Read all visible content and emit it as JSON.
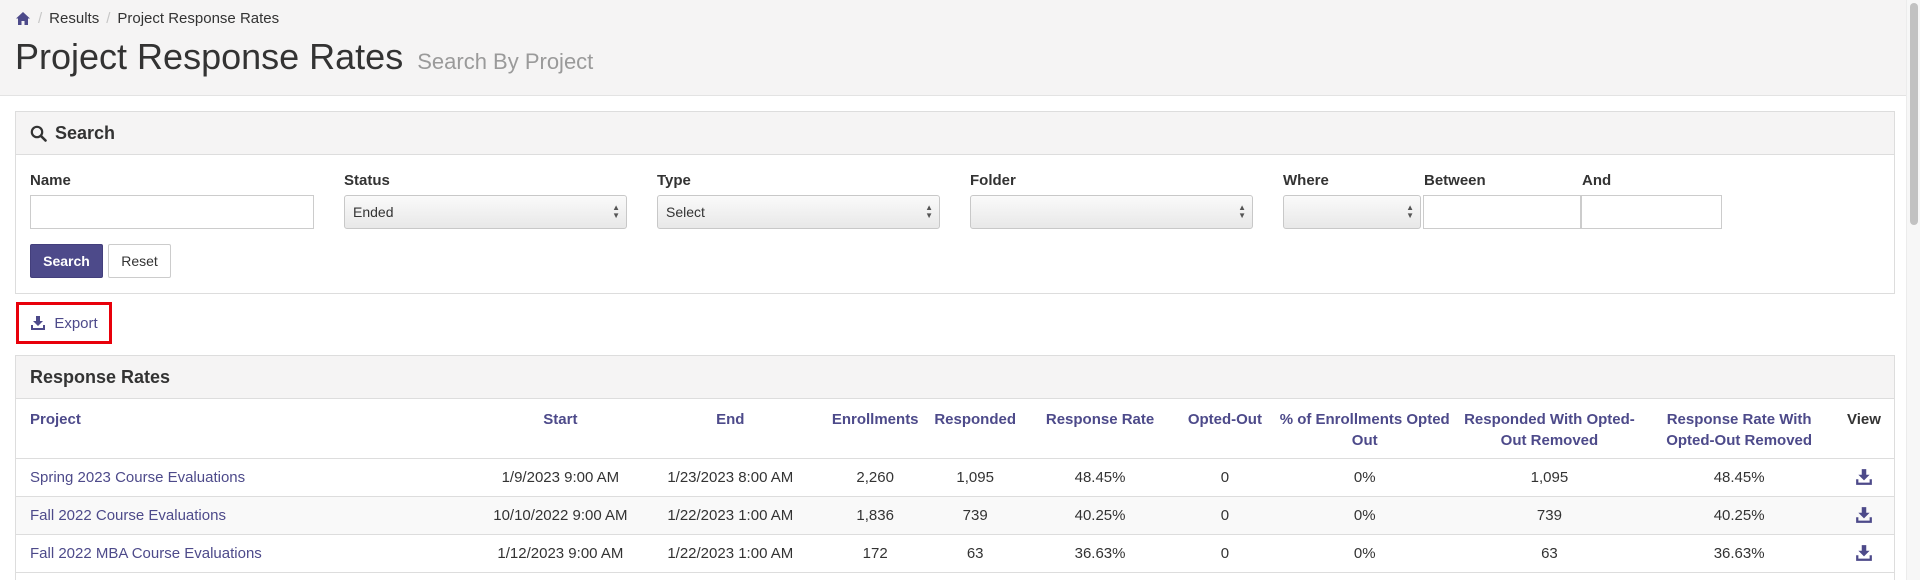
{
  "breadcrumb": {
    "items": [
      "Results",
      "Project Response Rates"
    ]
  },
  "header": {
    "title": "Project Response Rates",
    "subtitle": "Search By Project"
  },
  "search": {
    "heading": "Search",
    "fields": {
      "name": {
        "label": "Name",
        "value": ""
      },
      "status": {
        "label": "Status",
        "value": "Ended"
      },
      "type": {
        "label": "Type",
        "value": "Select"
      },
      "folder": {
        "label": "Folder",
        "value": ""
      },
      "where": {
        "label": "Where",
        "value": ""
      },
      "between": {
        "label": "Between",
        "value": ""
      },
      "and": {
        "label": "And",
        "value": ""
      }
    },
    "search_label": "Search",
    "reset_label": "Reset"
  },
  "export_label": "Export",
  "rates": {
    "heading": "Response Rates",
    "columns": [
      "Project",
      "Start",
      "End",
      "Enrollments",
      "Responded",
      "Response Rate",
      "Opted-Out",
      "% of Enrollments Opted Out",
      "Responded With Opted-Out Removed",
      "Response Rate With Opted-Out Removed",
      "View"
    ],
    "rows": [
      {
        "project": "Spring 2023 Course Evaluations",
        "start": "1/9/2023 9:00 AM",
        "end": "1/23/2023 8:00 AM",
        "enrollments": "2,260",
        "responded": "1,095",
        "rate": "48.45%",
        "opted_out": "0",
        "pct_opted": "0%",
        "responded_removed": "1,095",
        "rate_removed": "48.45%"
      },
      {
        "project": "Fall 2022 Course Evaluations",
        "start": "10/10/2022 9:00 AM",
        "end": "1/22/2023 1:00 AM",
        "enrollments": "1,836",
        "responded": "739",
        "rate": "40.25%",
        "opted_out": "0",
        "pct_opted": "0%",
        "responded_removed": "739",
        "rate_removed": "40.25%"
      },
      {
        "project": "Fall 2022 MBA Course Evaluations",
        "start": "1/12/2023 9:00 AM",
        "end": "1/22/2023 1:00 AM",
        "enrollments": "172",
        "responded": "63",
        "rate": "36.63%",
        "opted_out": "0",
        "pct_opted": "0%",
        "responded_removed": "63",
        "rate_removed": "36.63%"
      }
    ]
  },
  "colors": {
    "accent": "#4d4a8a",
    "highlight_border": "#e8000a",
    "header_bg": "#f5f4f4"
  },
  "icons": {
    "home": "home-icon",
    "search": "search-icon",
    "export": "download-icon",
    "view": "download-icon"
  }
}
